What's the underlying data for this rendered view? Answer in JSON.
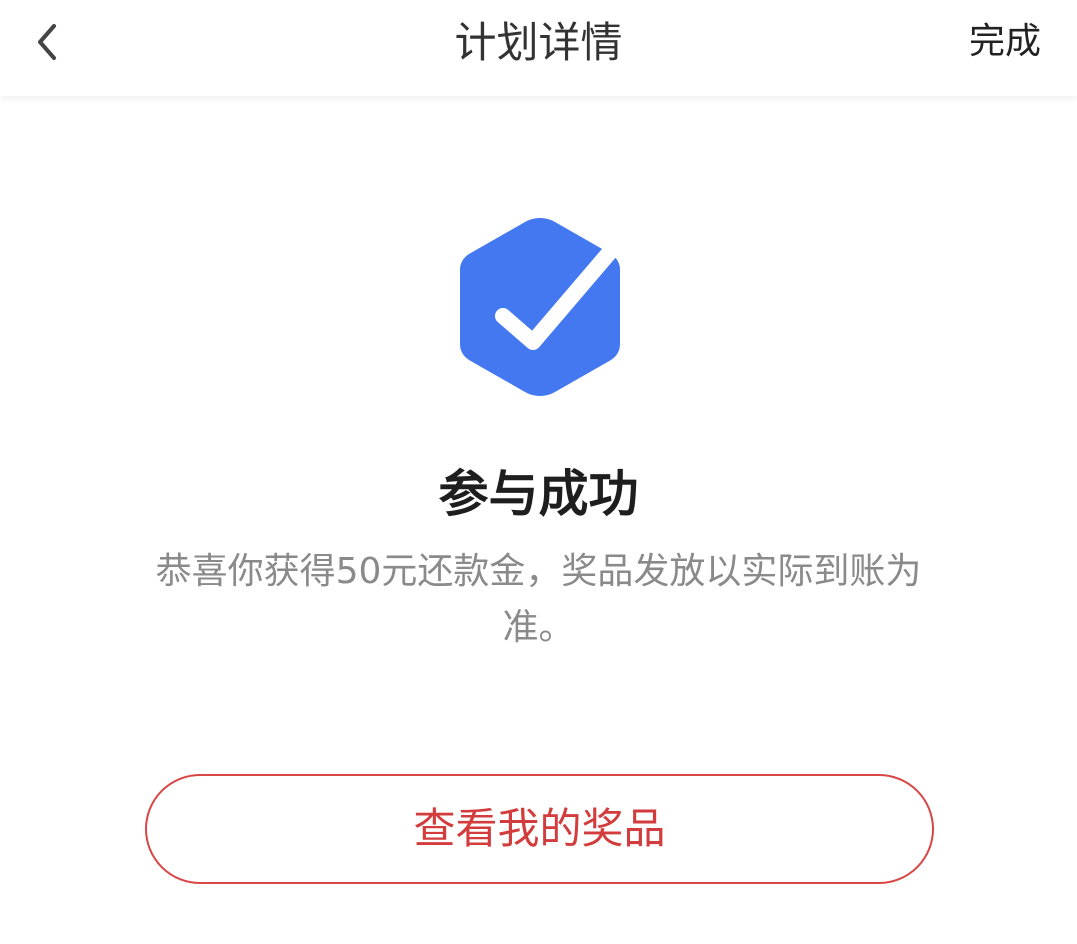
{
  "navbar": {
    "title": "计划详情",
    "done_label": "完成",
    "back_icon": "chevron-left-icon"
  },
  "result": {
    "icon": "check-hexagon-icon",
    "icon_color": "#4478f0",
    "title": "参与成功",
    "description": "恭喜你获得50元还款金，奖品发放以实际到账为准。"
  },
  "actions": {
    "view_prizes_label": "查看我的奖品",
    "accent_color": "#d94646"
  }
}
